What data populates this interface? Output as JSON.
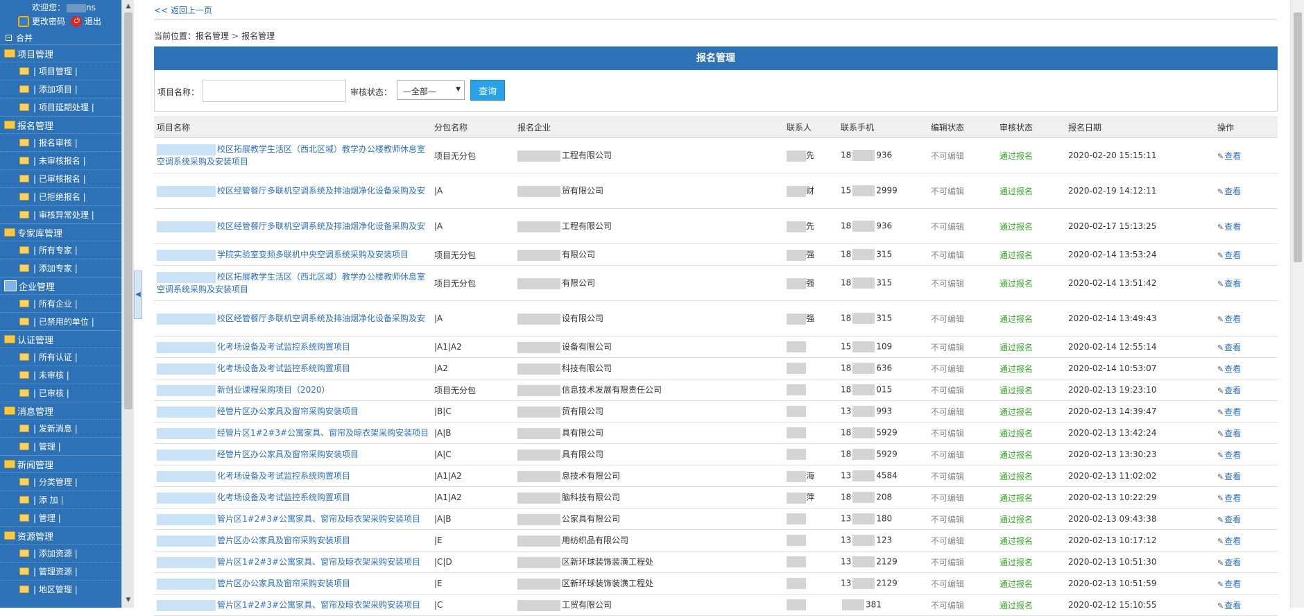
{
  "sidebar": {
    "welcome": "欢迎您：",
    "welcome_user_suffix": "ns",
    "change_password": "更改密码",
    "logout": "退出",
    "merge": "合并",
    "groups": [
      {
        "title": "项目管理",
        "items": [
          "项目管理",
          "添加项目",
          "项目延期处理"
        ]
      },
      {
        "title": "报名管理",
        "items": [
          "报名审核",
          "未审核报名",
          "已审核报名",
          "已拒绝报名",
          "审核异常处理"
        ]
      },
      {
        "title": "专家库管理",
        "items": [
          "所有专家",
          "添加专家"
        ]
      },
      {
        "title": "企业管理",
        "items": [
          "所有企业",
          "已禁用的单位"
        ]
      },
      {
        "title": "认证管理",
        "items": [
          "所有认证",
          "未审核",
          "已审核"
        ]
      },
      {
        "title": "消息管理",
        "items": [
          "发新消息",
          "管理"
        ]
      },
      {
        "title": "新闻管理",
        "items": [
          "分类管理",
          "添 加",
          "管理"
        ]
      },
      {
        "title": "资源管理",
        "items": [
          "添加资源",
          "管理资源",
          "地区管理"
        ]
      }
    ]
  },
  "main": {
    "back": "返回上一页",
    "crumb_label": "当前位置：",
    "crumb_1": "报名管理",
    "crumb_2": "报名管理",
    "panel_title": "报名管理",
    "search": {
      "project_label": "项目名称：",
      "project_value": "",
      "audit_label": "审核状态：",
      "audit_value": "—全部—",
      "button": "查询"
    },
    "columns": [
      "项目名称",
      "分包名称",
      "报名企业",
      "联系人",
      "联系手机",
      "编辑状态",
      "审核状态",
      "报名日期",
      "操作"
    ],
    "rows": [
      {
        "project": "校区拓展教学生活区（西北区域）教学办公楼教师休息室空调系统采购及安装项目",
        "package": "项目无分包",
        "company": "工程有限公司",
        "contact": "先",
        "phone_a": "18",
        "phone_b": "936",
        "edit": "不可编辑",
        "audit": "通过报名",
        "date": "2020-02-20 15:15:11",
        "op": "查看",
        "tall": true
      },
      {
        "project": "校区经管餐厅多联机空调系统及排油烟净化设备采购及安",
        "package": "|A",
        "company": "贸有限公司",
        "contact": "财",
        "phone_a": "15",
        "phone_b": "2999",
        "edit": "不可编辑",
        "audit": "通过报名",
        "date": "2020-02-19 14:12:11",
        "op": "查看",
        "tall": true
      },
      {
        "project": "校区经管餐厅多联机空调系统及排油烟净化设备采购及安",
        "package": "|A",
        "company": "工程有限公司",
        "contact": "先",
        "phone_a": "18",
        "phone_b": "936",
        "edit": "不可编辑",
        "audit": "通过报名",
        "date": "2020-02-17 15:13:25",
        "op": "查看",
        "tall": true
      },
      {
        "project": "学院实验室变频多联机中央空调系统采购及安装项目",
        "package": "项目无分包",
        "company": "有限公司",
        "contact": "强",
        "phone_a": "18",
        "phone_b": "315",
        "edit": "不可编辑",
        "audit": "通过报名",
        "date": "2020-02-14 13:53:24",
        "op": "查看",
        "tall": false
      },
      {
        "project": "校区拓展教学生活区（西北区域）教学办公楼教师休息室空调系统采购及安装项目",
        "package": "项目无分包",
        "company": "有限公司",
        "contact": "强",
        "phone_a": "18",
        "phone_b": "315",
        "edit": "不可编辑",
        "audit": "通过报名",
        "date": "2020-02-14 13:51:42",
        "op": "查看",
        "tall": true
      },
      {
        "project": "校区经管餐厅多联机空调系统及排油烟净化设备采购及安",
        "package": "|A",
        "company": "设有限公司",
        "contact": "强",
        "phone_a": "18",
        "phone_b": "315",
        "edit": "不可编辑",
        "audit": "通过报名",
        "date": "2020-02-14 13:49:43",
        "op": "查看",
        "tall": true
      },
      {
        "project": "化考场设备及考试监控系统购置项目",
        "package": "|A1|A2",
        "company": "设备有限公司",
        "contact": "",
        "phone_a": "15",
        "phone_b": "109",
        "edit": "不可编辑",
        "audit": "通过报名",
        "date": "2020-02-14 12:55:14",
        "op": "查看",
        "tall": false
      },
      {
        "project": "化考场设备及考试监控系统购置项目",
        "package": "|A2",
        "company": "科技有限公司",
        "contact": "",
        "phone_a": "18",
        "phone_b": "636",
        "edit": "不可编辑",
        "audit": "通过报名",
        "date": "2020-02-14 10:53:07",
        "op": "查看",
        "tall": false
      },
      {
        "project": "新创业课程采购项目（2020）",
        "package": "项目无分包",
        "company": "信息技术发展有限责任公司",
        "contact": "",
        "phone_a": "18",
        "phone_b": "015",
        "edit": "不可编辑",
        "audit": "通过报名",
        "date": "2020-02-13 19:23:10",
        "op": "查看",
        "tall": false
      },
      {
        "project": "经管片区办公家具及窗帘采购安装项目",
        "package": "|B|C",
        "company": "贸有限公司",
        "contact": "",
        "phone_a": "13",
        "phone_b": "993",
        "edit": "不可编辑",
        "audit": "通过报名",
        "date": "2020-02-13 14:39:47",
        "op": "查看",
        "tall": false
      },
      {
        "project": "经管片区1#2#3#公寓家具、窗帘及晾衣架采购安装项目",
        "package": "|A|B",
        "company": "具有限公司",
        "contact": "",
        "phone_a": "18",
        "phone_b": "5929",
        "edit": "不可编辑",
        "audit": "通过报名",
        "date": "2020-02-13 13:42:24",
        "op": "查看",
        "tall": false
      },
      {
        "project": "经管片区办公家具及窗帘采购安装项目",
        "package": "|A|C",
        "company": "具有限公司",
        "contact": "",
        "phone_a": "18",
        "phone_b": "5929",
        "edit": "不可编辑",
        "audit": "通过报名",
        "date": "2020-02-13 13:30:23",
        "op": "查看",
        "tall": false
      },
      {
        "project": "化考场设备及考试监控系统购置项目",
        "package": "|A1|A2",
        "company": "息技术有限公司",
        "contact": "海",
        "phone_a": "13",
        "phone_b": "4584",
        "edit": "不可编辑",
        "audit": "通过报名",
        "date": "2020-02-13 11:02:02",
        "op": "查看",
        "tall": false
      },
      {
        "project": "化考场设备及考试监控系统购置项目",
        "package": "|A1|A2",
        "company": "脑科技有限公司",
        "contact": "萍",
        "phone_a": "18",
        "phone_b": "208",
        "edit": "不可编辑",
        "audit": "通过报名",
        "date": "2020-02-13 10:22:29",
        "op": "查看",
        "tall": false
      },
      {
        "project": "管片区1#2#3#公寓家具、窗帘及晾衣架采购安装项目",
        "package": "|A|B",
        "company": "公家具有限公司",
        "contact": "",
        "phone_a": "13",
        "phone_b": "180",
        "edit": "不可编辑",
        "audit": "通过报名",
        "date": "2020-02-13 09:43:38",
        "op": "查看",
        "tall": false
      },
      {
        "project": "管片区办公家具及窗帘采购安装项目",
        "package": "|E",
        "company": "用纺织品有限公司",
        "contact": "",
        "phone_a": "13",
        "phone_b": "123",
        "edit": "不可编辑",
        "audit": "通过报名",
        "date": "2020-02-13 10:17:12",
        "op": "查看",
        "tall": false
      },
      {
        "project": "管片区1#2#3#公寓家具、窗帘及晾衣架采购安装项目",
        "package": "|C|D",
        "company": "区新环球装饰装潢工程处",
        "contact": "",
        "phone_a": "13",
        "phone_b": "2129",
        "edit": "不可编辑",
        "audit": "通过报名",
        "date": "2020-02-13 10:51:30",
        "op": "查看",
        "tall": false
      },
      {
        "project": "管片区办公家具及窗帘采购安装项目",
        "package": "|E",
        "company": "区新环球装饰装潢工程处",
        "contact": "",
        "phone_a": "13",
        "phone_b": "2129",
        "edit": "不可编辑",
        "audit": "通过报名",
        "date": "2020-02-13 10:51:59",
        "op": "查看",
        "tall": false
      },
      {
        "project": "管片区1#2#3#公寓家具、窗帘及晾衣架采购安装项目",
        "package": "|C",
        "company": "工贸有限公司",
        "contact": "",
        "phone_a": "",
        "phone_b": "381",
        "edit": "不可编辑",
        "audit": "通过报名",
        "date": "2020-02-12 15:10:55",
        "op": "查看",
        "tall": false
      }
    ]
  }
}
